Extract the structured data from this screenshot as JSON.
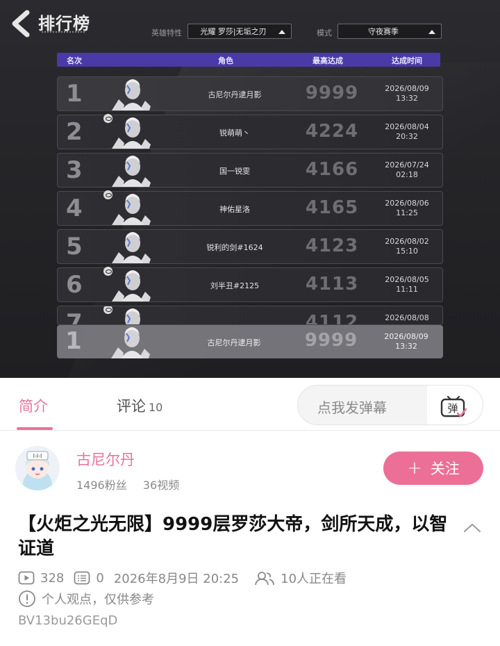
{
  "game": {
    "title": "排行榜",
    "filter_hero_label": "英雄特性",
    "filter_hero_value": "光耀 罗莎|无垢之刃",
    "filter_mode_label": "模式",
    "filter_mode_value": "守夜赛季",
    "columns": {
      "rank": "名次",
      "role": "角色",
      "best": "最高达成",
      "time": "达成时间"
    },
    "rows": [
      {
        "rank": "1",
        "name": "古尼尔丹逮月影",
        "score": "9999",
        "date": "2026/08/09",
        "time": "13:32",
        "eye": false
      },
      {
        "rank": "2",
        "name": "锐萌萌丶",
        "score": "4224",
        "date": "2026/08/04",
        "time": "20:32",
        "eye": true
      },
      {
        "rank": "3",
        "name": "国一锐雯",
        "score": "4166",
        "date": "2026/07/24",
        "time": "02:18",
        "eye": false
      },
      {
        "rank": "4",
        "name": "神佑星洛",
        "score": "4165",
        "date": "2026/08/06",
        "time": "11:25",
        "eye": true
      },
      {
        "rank": "5",
        "name": "锐利的剑#1624",
        "score": "4123",
        "date": "2026/08/02",
        "time": "15:10",
        "eye": false
      },
      {
        "rank": "6",
        "name": "刘半丑#2125",
        "score": "4113",
        "date": "2026/08/05",
        "time": "11:11",
        "eye": true
      },
      {
        "rank": "7",
        "name": "",
        "score": "4112",
        "date": "2026/08/08",
        "time": "",
        "eye": true
      }
    ],
    "self_row": {
      "rank": "1",
      "name": "古尼尔丹逮月影",
      "score": "9999",
      "date": "2026/08/09",
      "time": "13:32"
    }
  },
  "tabs": {
    "intro": "简介",
    "comments": "评论",
    "comments_count": "10",
    "danmaku_placeholder": "点我发弹幕",
    "danmaku_icon_glyph": "弹"
  },
  "uploader": {
    "name": "古尼尔丹",
    "fans": "1496粉丝",
    "videos": "36视频",
    "follow_label": "关注",
    "follow_plus": "+",
    "follow_color": "#ec6f97"
  },
  "video": {
    "title": "【火炬之光无限】9999层罗莎大帝，剑所天成，以智证道",
    "plays": "328",
    "danmaku_count": "0",
    "publish_time": "2026年8月9日 20:25",
    "watching": "10人正在看",
    "notice": "个人观点，仅供参考",
    "bvid": "BV13bu26GEqD"
  },
  "theme": {
    "accent": "#e8739a",
    "table_header": "#4a3aa8"
  }
}
